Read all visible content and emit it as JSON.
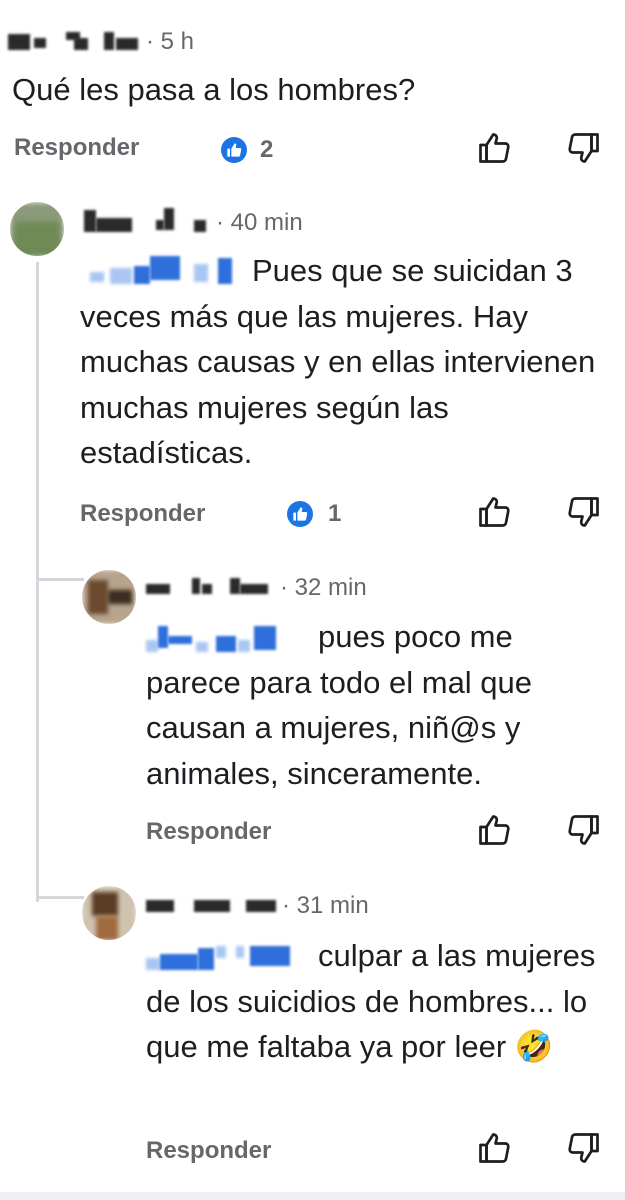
{
  "comments": [
    {
      "time": "· 5 h",
      "text": "Qué les pasa a los hombres?",
      "reply_label": "Responder",
      "likes": "2"
    },
    {
      "time": "· 40 min",
      "text_line1": "Pues que se suicidan",
      "text_rest": "3 veces más que las mujeres. Hay muchas causas y en ellas intervienen muchas mujeres según las estadísticas.",
      "reply_label": "Responder",
      "likes": "1"
    },
    {
      "time": "· 32 min",
      "text_line1": "pues poco me",
      "text_rest": "parece para todo el mal que causan a mujeres, niñ@s y animales, sinceramente.",
      "reply_label": "Responder"
    },
    {
      "time": "· 31 min",
      "text_line1": "culpar a las",
      "text_rest": "mujeres de los suicidios de hombres... lo que me faltaba ya por leer",
      "emoji": "🤣",
      "reply_label": "Responder"
    }
  ],
  "icons": {
    "like": "thumbs-up-icon",
    "dislike": "thumbs-down-icon",
    "reaction": "like-reaction-icon"
  },
  "colors": {
    "accent": "#1b74e4",
    "muted": "#65676b",
    "thread_line": "#d3d6db"
  }
}
